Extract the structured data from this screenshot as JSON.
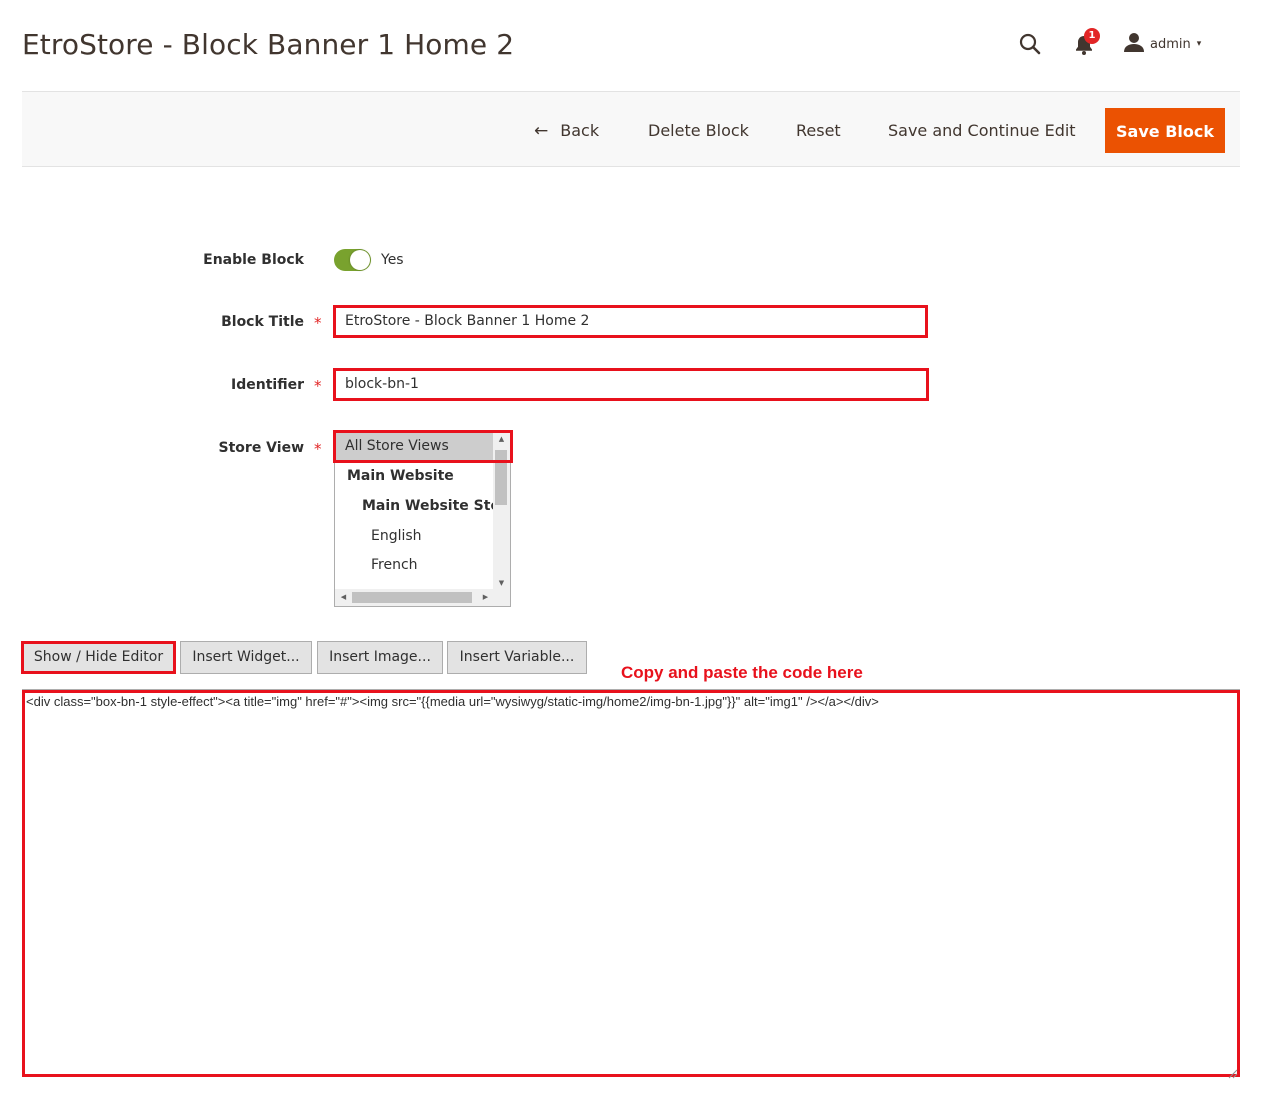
{
  "page": {
    "title": "EtroStore - Block Banner 1 Home 2"
  },
  "header": {
    "search_icon": "search-icon",
    "notifications_icon": "bell-icon",
    "notifications_count": "1",
    "user_icon": "user-icon",
    "user_label": "admin",
    "user_caret": "▾"
  },
  "toolbar": {
    "back_arrow": "←",
    "back_label": "Back",
    "delete_label": "Delete Block",
    "reset_label": "Reset",
    "save_continue_label": "Save and Continue Edit",
    "save_label": "Save Block",
    "save_color": "#eb5202"
  },
  "form": {
    "enable": {
      "label": "Enable Block",
      "value": "Yes",
      "on": true,
      "color": "#79a22e"
    },
    "title": {
      "label": "Block Title",
      "required_mark": "*",
      "value": "EtroStore - Block Banner 1 Home 2"
    },
    "identifier": {
      "label": "Identifier",
      "required_mark": "*",
      "value": "block-bn-1"
    },
    "store_view": {
      "label": "Store View",
      "required_mark": "*",
      "options": [
        {
          "label": "All Store Views",
          "selected": true
        },
        {
          "label": "Main Website",
          "selected": false
        },
        {
          "label": "Main Website Store",
          "selected": false
        },
        {
          "label": "English",
          "selected": false
        },
        {
          "label": "French",
          "selected": false
        }
      ],
      "scroll_up": "▲",
      "scroll_down": "▼",
      "scroll_left": "◀",
      "scroll_right": "▶"
    }
  },
  "editor": {
    "show_hide_label": "Show / Hide Editor",
    "insert_widget_label": "Insert Widget...",
    "insert_image_label": "Insert Image...",
    "insert_variable_label": "Insert Variable...",
    "content": "<div class=\"box-bn-1 style-effect\"><a title=\"img\" href=\"#\"><img src=\"{{media url=\"wysiwyg/static-img/home2/img-bn-1.jpg\"}}\" alt=\"img1\" /></a></div>"
  },
  "annotation": {
    "text": "Copy and paste the code here",
    "color": "#e8111c"
  }
}
